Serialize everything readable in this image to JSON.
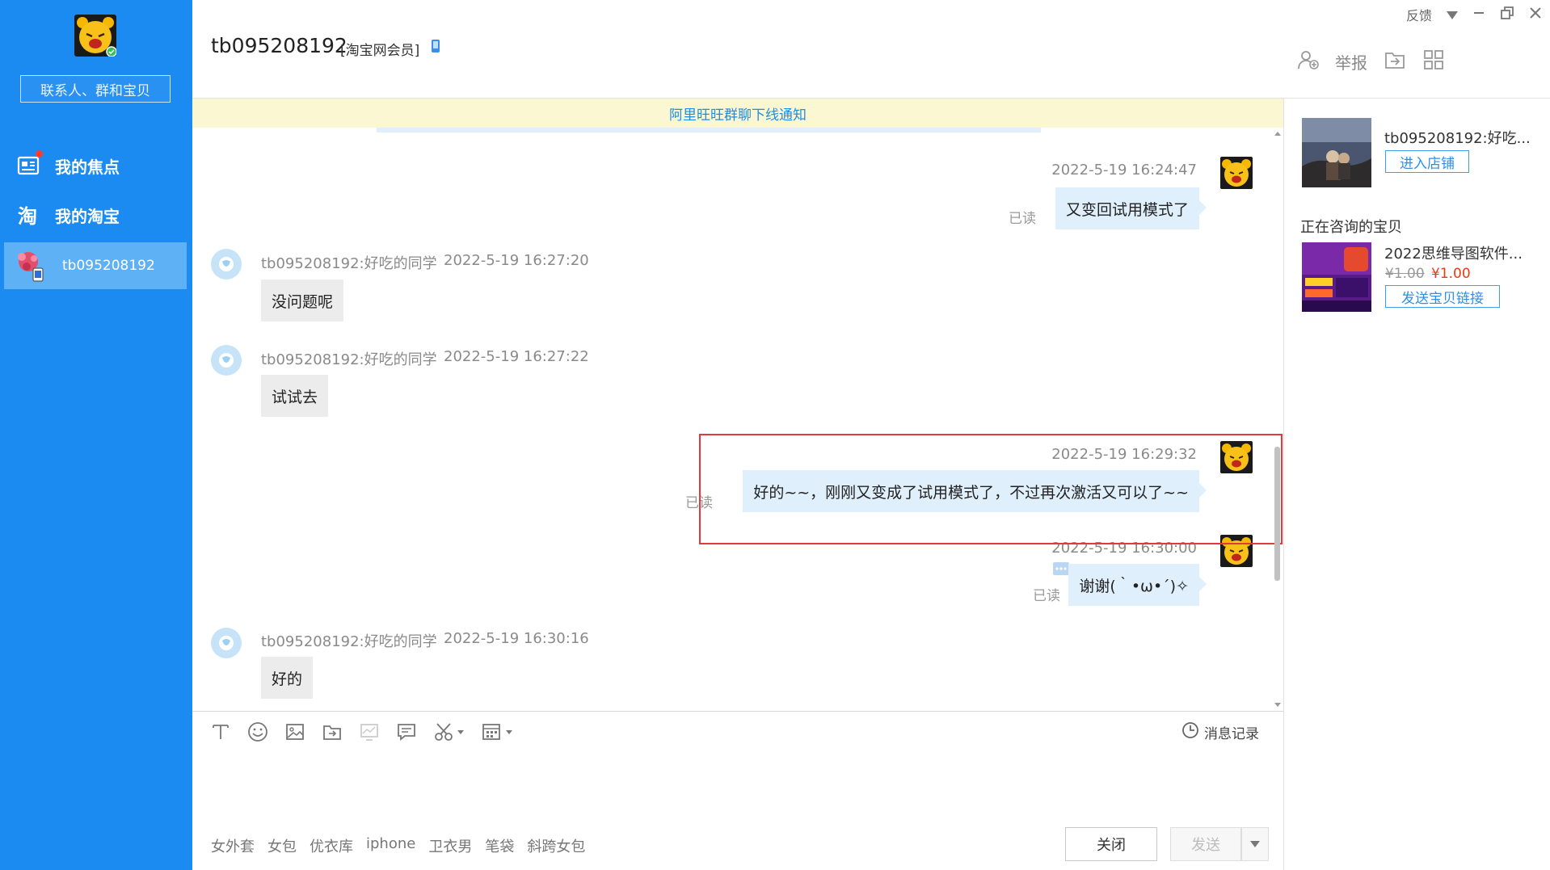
{
  "sidebar": {
    "search_placeholder": "联系人、群和宝贝",
    "items": [
      {
        "label": "我的焦点"
      },
      {
        "label": "我的淘宝"
      },
      {
        "label": "tb095208192"
      }
    ]
  },
  "header": {
    "contact_name": "tb095208192",
    "member_tag": "[淘宝网会员]",
    "report_label": "举报",
    "feedback_label": "反馈"
  },
  "notice": "阿里旺旺群聊下线通知",
  "messages": [
    {
      "side": "right",
      "time": "2022-5-19 16:24:47",
      "text": "又变回试用模式了",
      "status": "已读"
    },
    {
      "side": "left",
      "sender": "tb095208192:好吃的同学",
      "time": "2022-5-19 16:27:20",
      "text": "没问题呢"
    },
    {
      "side": "left",
      "sender": "tb095208192:好吃的同学",
      "time": "2022-5-19 16:27:22",
      "text": "试试去"
    },
    {
      "side": "right",
      "time": "2022-5-19 16:29:32",
      "text": "好的~~，刚刚又变成了试用模式了，不过再次激活又可以了~~",
      "status": "已读"
    },
    {
      "side": "right",
      "time": "2022-5-19 16:30:00",
      "text": "谢谢(｀•ω•´)✧",
      "status": "已读"
    },
    {
      "side": "left",
      "sender": "tb095208192:好吃的同学",
      "time": "2022-5-19 16:30:16",
      "text": "好的"
    }
  ],
  "input": {
    "history_label": "消息记录",
    "quick_tags": [
      "女外套",
      "女包",
      "优衣库",
      "iphone",
      "卫衣男",
      "笔袋",
      "斜跨女包"
    ],
    "close_label": "关闭",
    "send_label": "发送"
  },
  "right_panel": {
    "shop_name": "tb095208192:好吃...",
    "enter_shop_label": "进入店铺",
    "consult_title": "正在咨询的宝贝",
    "product_name": "2022思维导图软件...",
    "price_old": "¥1.00",
    "price_new": "¥1.00",
    "send_link_label": "发送宝贝链接"
  },
  "colors": {
    "accent": "#1b8bf2",
    "bubble_self": "#e0effc",
    "bubble_peer": "#ececec",
    "highlight": "#e03b3b",
    "price": "#f0380f"
  }
}
